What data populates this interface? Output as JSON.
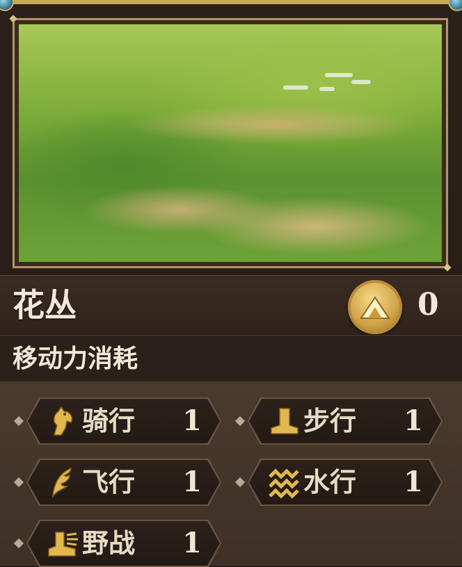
{
  "terrain": {
    "name": "花丛",
    "cost_icon": "mountain-icon",
    "cost_value": "0"
  },
  "section": {
    "title": "移动力消耗"
  },
  "movement": [
    {
      "icon": "horse-icon",
      "label": "骑行",
      "value": "1"
    },
    {
      "icon": "boot-icon",
      "label": "步行",
      "value": "1"
    },
    {
      "icon": "wing-icon",
      "label": "飞行",
      "value": "1"
    },
    {
      "icon": "wave-icon",
      "label": "水行",
      "value": "1"
    },
    {
      "icon": "running-boot-icon",
      "label": "野战",
      "value": "1"
    }
  ],
  "colors": {
    "panel_bg": "#2b211a",
    "gold": "#d1a347",
    "text": "#f2ead8",
    "grass": "#7fae3a"
  }
}
